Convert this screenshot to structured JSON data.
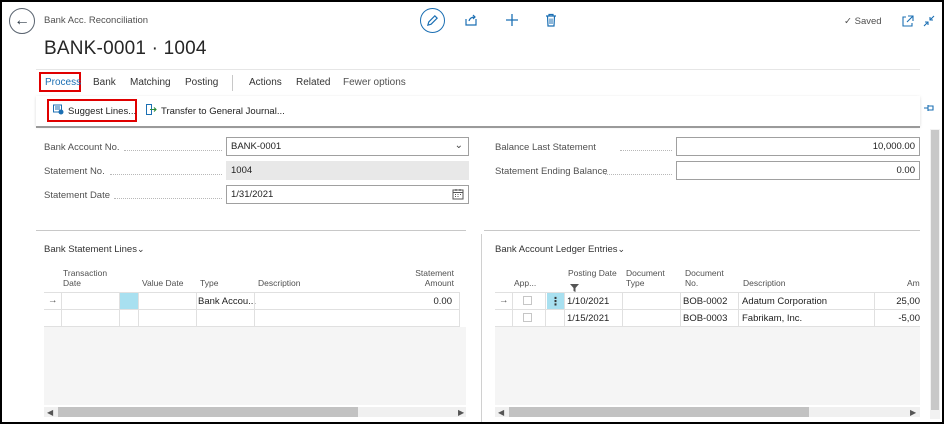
{
  "header": {
    "breadcrumb": "Bank Acc. Reconciliation",
    "title": "BANK-0001 · 1004",
    "saved_label": "Saved",
    "saved_check": "✓"
  },
  "actionbar": {
    "tabs": [
      "Process",
      "Bank",
      "Matching",
      "Posting",
      "Actions",
      "Related",
      "Fewer options"
    ],
    "active_tab": "Process",
    "process_actions": [
      "Suggest Lines...",
      "Transfer to General Journal..."
    ]
  },
  "form": {
    "bank_account_no_label": "Bank Account No.",
    "bank_account_no": "BANK-0001",
    "statement_no_label": "Statement No.",
    "statement_no": "1004",
    "statement_date_label": "Statement Date",
    "statement_date": "1/31/2021",
    "balance_last_statement_label": "Balance Last Statement",
    "balance_last_statement": "10,000.00",
    "statement_ending_balance_label": "Statement Ending Balance",
    "statement_ending_balance": "0.00"
  },
  "bank_statement_lines": {
    "title": "Bank Statement Lines",
    "columns": [
      "Transaction Date",
      "Value Date",
      "Type",
      "Description",
      "Statement Amount"
    ],
    "rows": [
      {
        "transaction_date": "",
        "value_date": "",
        "type": "Bank Accou...",
        "description": "",
        "statement_amount": "0.00"
      }
    ]
  },
  "ledger_entries": {
    "title": "Bank Account Ledger Entries",
    "columns": [
      "App...",
      "Posting Date",
      "Document Type",
      "Document No.",
      "Description",
      "Am"
    ],
    "rows": [
      {
        "posting_date": "1/10/2021",
        "document_type": "",
        "document_no": "BOB-0002",
        "description": "Adatum Corporation",
        "amount": "25,00"
      },
      {
        "posting_date": "1/15/2021",
        "document_type": "",
        "document_no": "BOB-0003",
        "description": "Fabrikam, Inc.",
        "amount": "-5,00"
      }
    ]
  },
  "colors": {
    "accent": "#1b6fb3",
    "highlight": "#e00000",
    "selected_cell": "#a8e0f0"
  },
  "icons": [
    "back-arrow-icon",
    "edit-icon",
    "share-icon",
    "add-icon",
    "delete-icon",
    "check-icon",
    "open-in-new-icon",
    "collapse-icon",
    "suggest-lines-icon",
    "transfer-icon",
    "pin-icon",
    "chevron-down-icon",
    "calendar-icon",
    "row-arrow-icon",
    "row-menu-icon",
    "filter-icon"
  ]
}
